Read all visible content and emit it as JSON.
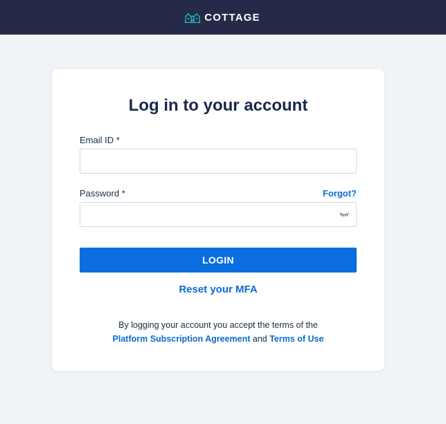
{
  "header": {
    "brand_name": "COTTAGE",
    "brand_icon": "cottage-logo-icon",
    "background_color": "#252a48",
    "accent_color": "#1fc0c4"
  },
  "login_form": {
    "title": "Log in to your account",
    "email_label": "Email ID *",
    "email_value": "",
    "password_label": "Password *",
    "password_value": "",
    "forgot_link": "Forgot?",
    "password_toggle_icon": "eye-closed-icon",
    "login_button": "LOGIN",
    "reset_mfa_link": "Reset your MFA",
    "terms_prefix": "By logging your account you accept the terms of the",
    "terms_link_1": "Platform Subscription Agreement",
    "terms_and": "and",
    "terms_link_2": "Terms of Use",
    "button_color": "#0a6ee0",
    "link_color": "#0b6bd3"
  }
}
